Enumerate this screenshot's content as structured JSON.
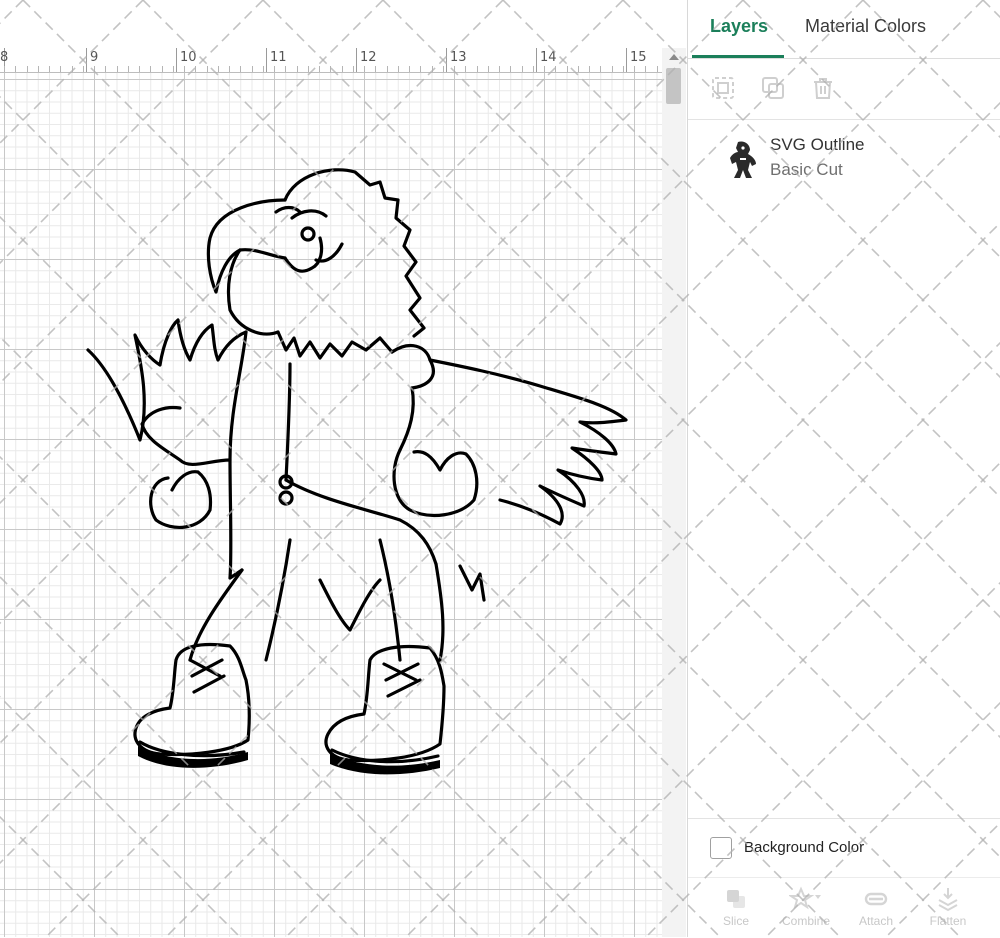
{
  "ruler": {
    "labels": [
      "8",
      "9",
      "10",
      "11",
      "12",
      "13",
      "14",
      "15"
    ]
  },
  "canvas": {
    "design_name": "eagle-mascot-outline"
  },
  "panel": {
    "tabs": {
      "layers": "Layers",
      "material_colors": "Material Colors"
    },
    "toolbar": [
      "group-icon",
      "duplicate-icon",
      "trash-icon"
    ],
    "layer": {
      "name": "SVG Outline",
      "operation": "Basic Cut"
    },
    "background_color_label": "Background Color",
    "bottom_actions": [
      {
        "label": "Slice",
        "icon": "slice-icon"
      },
      {
        "label": "Combine",
        "icon": "combine-icon"
      },
      {
        "label": "Attach",
        "icon": "attach-icon"
      },
      {
        "label": "Flatten",
        "icon": "flatten-icon"
      }
    ]
  },
  "colors": {
    "accent": "#1b7f5a",
    "grid_major": "#c8c8c8",
    "grid_minor": "#e9e9e9"
  }
}
